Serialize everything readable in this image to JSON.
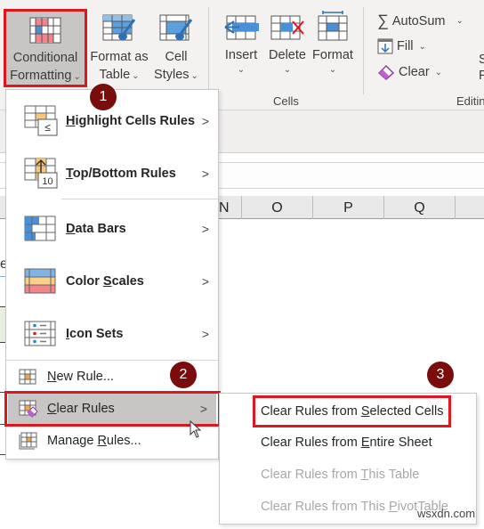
{
  "ribbon": {
    "styles_group": {
      "conditional_formatting": {
        "line1": "Conditional",
        "line2": "Formatting",
        "chevron": "⌄"
      },
      "format_as_table": {
        "line1": "Format as",
        "line2": "Table",
        "chevron": "⌄"
      },
      "cell_styles": {
        "line1": "Cell",
        "line2": "Styles",
        "chevron": "⌄"
      }
    },
    "cells_group": {
      "label": "Cells",
      "insert": "Insert",
      "delete": "Delete",
      "format": "Format"
    },
    "editing_group": {
      "label": "Editin",
      "autosum": "AutoSum",
      "fill": "Fill",
      "clear": "Clear",
      "truncated_s": "S",
      "truncated_f": "F"
    }
  },
  "grid": {
    "columns": [
      "N",
      "O",
      "P",
      "Q"
    ],
    "partial_row_char": "e"
  },
  "menu": {
    "big_items": [
      {
        "pre": "",
        "u": "H",
        "post": "ighlight Cells Rules",
        "icon": "highlight-cells-icon"
      },
      {
        "pre": "",
        "u": "T",
        "post": "op/Bottom Rules",
        "icon": "top-bottom-icon"
      },
      {
        "pre": "",
        "u": "D",
        "post": "ata Bars",
        "icon": "data-bars-icon"
      },
      {
        "pre": "Color ",
        "u": "S",
        "post": "cales",
        "icon": "color-scales-icon"
      },
      {
        "pre": "",
        "u": "I",
        "post": "con Sets",
        "icon": "icon-sets-icon"
      }
    ],
    "small_items": [
      {
        "pre": "",
        "u": "N",
        "post": "ew Rule...",
        "icon": "new-rule-icon"
      },
      {
        "pre": "",
        "u": "C",
        "post": "lear Rules",
        "icon": "clear-rules-icon"
      },
      {
        "pre": "Manage ",
        "u": "R",
        "post": "ules...",
        "icon": "manage-rules-icon"
      }
    ],
    "submenu_arrow": ">"
  },
  "submenu": {
    "items": [
      {
        "pre": "Clear Rules from ",
        "u": "S",
        "post": "elected Cells",
        "enabled": true
      },
      {
        "pre": "Clear Rules from ",
        "u": "E",
        "post": "ntire Sheet",
        "enabled": true
      },
      {
        "pre": "Clear Rules from ",
        "u": "T",
        "post": "his Table",
        "enabled": false
      },
      {
        "pre": "Clear Rules from This ",
        "u": "P",
        "post": "ivotTable",
        "enabled": false
      }
    ]
  },
  "badges": [
    "1",
    "2",
    "3"
  ],
  "watermark": "wsxdn.com",
  "colors": {
    "highlight_box": "#e0161e",
    "badge": "#7a0c0c",
    "hover_bg": "#c8c6c4"
  }
}
